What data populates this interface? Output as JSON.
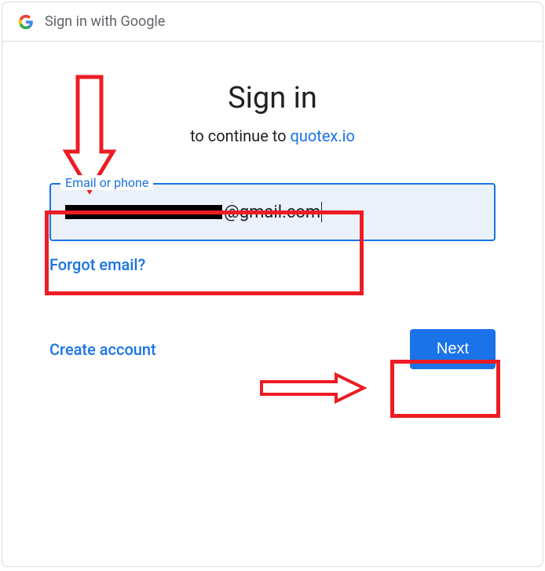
{
  "header": {
    "title": "Sign in with Google"
  },
  "main": {
    "title": "Sign in",
    "subtitle_prefix": "to continue to ",
    "subtitle_link_text": "quotex.io",
    "email_label": "Email or phone",
    "email_value_suffix": "@gmail.com",
    "forgot_email": "Forgot email?",
    "create_account": "Create account",
    "next": "Next"
  },
  "colors": {
    "accent": "#1a73e8",
    "annotation": "#ed1c24"
  }
}
